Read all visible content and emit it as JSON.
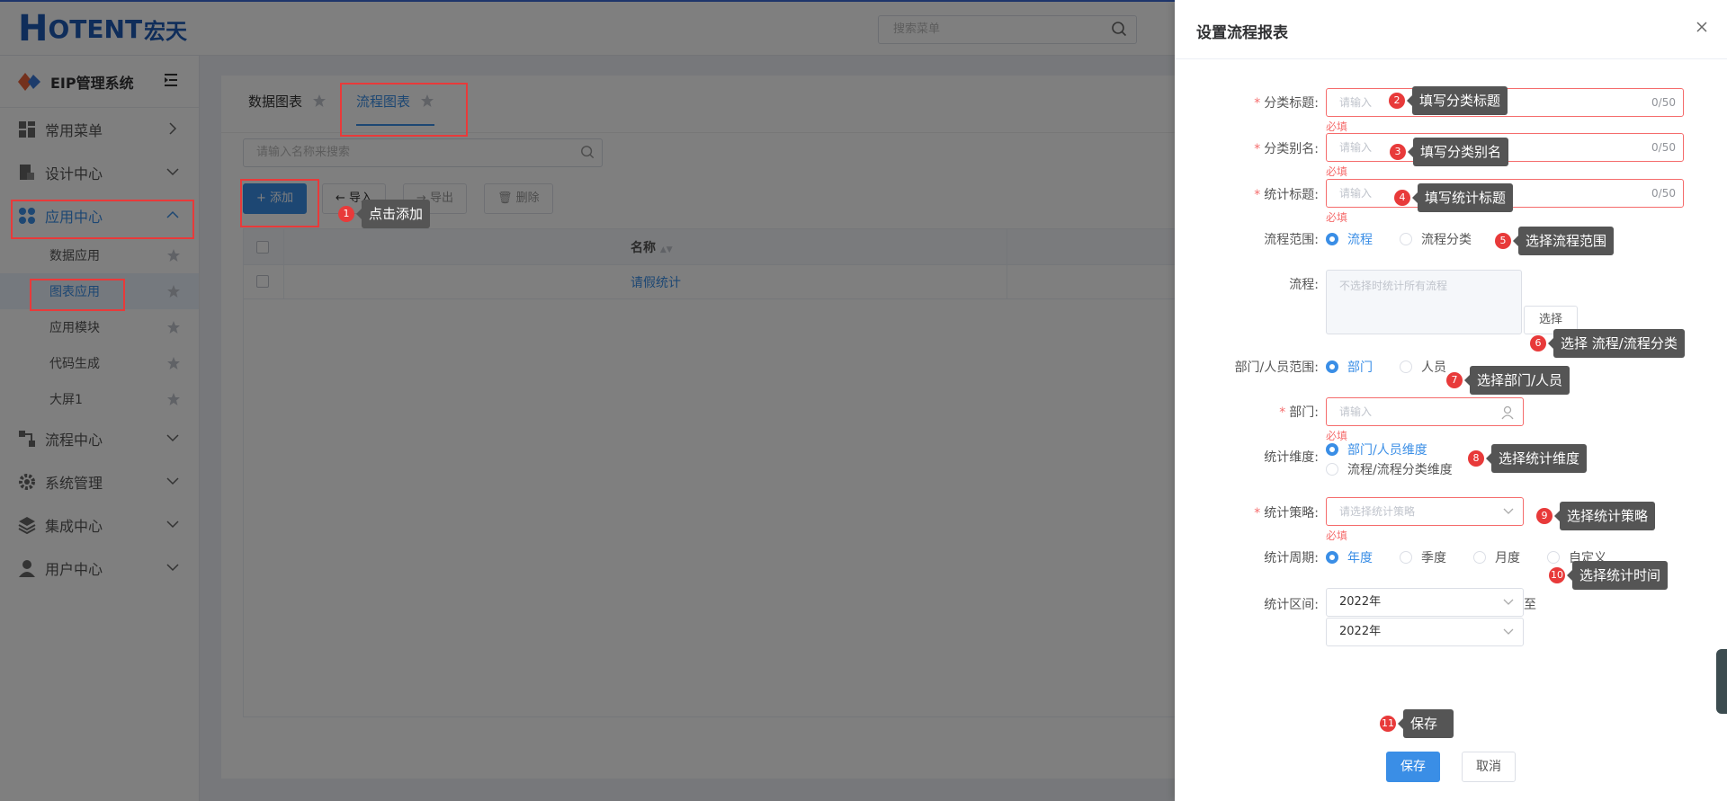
{
  "header": {
    "logo_h": "H",
    "logo_text": "OTENT",
    "logo_cn": "宏天",
    "search_placeholder": "搜索菜单"
  },
  "sidebar": {
    "system_title": "EIP管理系统",
    "menu": [
      {
        "label": "常用菜单"
      },
      {
        "label": "设计中心"
      },
      {
        "label": "应用中心"
      },
      {
        "label": "流程中心"
      },
      {
        "label": "系统管理"
      },
      {
        "label": "集成中心"
      },
      {
        "label": "用户中心"
      }
    ],
    "submenu": [
      {
        "label": "数据应用"
      },
      {
        "label": "图表应用"
      },
      {
        "label": "应用模块"
      },
      {
        "label": "代码生成"
      },
      {
        "label": "大屏1"
      }
    ]
  },
  "main": {
    "tabs": [
      {
        "label": "数据图表"
      },
      {
        "label": "流程图表"
      }
    ],
    "search_placeholder": "请输入名称来搜索",
    "buttons": {
      "add": "+ 添加",
      "import": "导入",
      "export": "导出",
      "delete": "删除"
    },
    "table": {
      "col_name": "名称",
      "rows": [
        {
          "name": "请假统计"
        }
      ]
    }
  },
  "drawer": {
    "title": "设置流程报表",
    "fields": {
      "category_title": {
        "label": "分类标题:",
        "placeholder": "请输入",
        "count": "0/50",
        "error": "必填"
      },
      "category_alias": {
        "label": "分类别名:",
        "placeholder": "请输入",
        "count": "0/50",
        "error": "必填"
      },
      "stat_title": {
        "label": "统计标题:",
        "placeholder": "请输入",
        "count": "0/50",
        "error": "必填"
      },
      "flow_scope": {
        "label": "流程范围:",
        "opt1": "流程",
        "opt2": "流程分类"
      },
      "flow": {
        "label": "流程:",
        "placeholder": "不选择时统计所有流程",
        "button": "选择"
      },
      "dept_scope": {
        "label": "部门/人员范围:",
        "opt1": "部门",
        "opt2": "人员"
      },
      "dept": {
        "label": "部门:",
        "placeholder": "请输入",
        "error": "必填"
      },
      "dimension": {
        "label": "统计维度:",
        "opt1": "部门/人员维度",
        "opt2": "流程/流程分类维度"
      },
      "strategy": {
        "label": "统计策略:",
        "placeholder": "请选择统计策略",
        "error": "必填"
      },
      "period": {
        "label": "统计周期:",
        "opt1": "年度",
        "opt2": "季度",
        "opt3": "月度",
        "opt4": "自定义"
      },
      "range": {
        "label": "统计区间:",
        "start": "2022年",
        "to": "至",
        "end": "2022年"
      }
    },
    "save": "保存",
    "cancel": "取消"
  },
  "callouts": [
    {
      "num": "1",
      "text": "点击添加"
    },
    {
      "num": "2",
      "text": "填写分类标题"
    },
    {
      "num": "3",
      "text": "填写分类别名"
    },
    {
      "num": "4",
      "text": "填写统计标题"
    },
    {
      "num": "5",
      "text": "选择流程范围"
    },
    {
      "num": "6",
      "text": "选择 流程/流程分类"
    },
    {
      "num": "7",
      "text": "选择部门/人员"
    },
    {
      "num": "8",
      "text": "选择统计维度"
    },
    {
      "num": "9",
      "text": "选择统计策略"
    },
    {
      "num": "10",
      "text": "选择统计时间"
    },
    {
      "num": "11",
      "text": "保存"
    }
  ],
  "colors": {
    "accent": "#3a8ee6",
    "error": "#f56c6c",
    "highlight": "#e83a3a",
    "logo": "#1f5bb5"
  }
}
